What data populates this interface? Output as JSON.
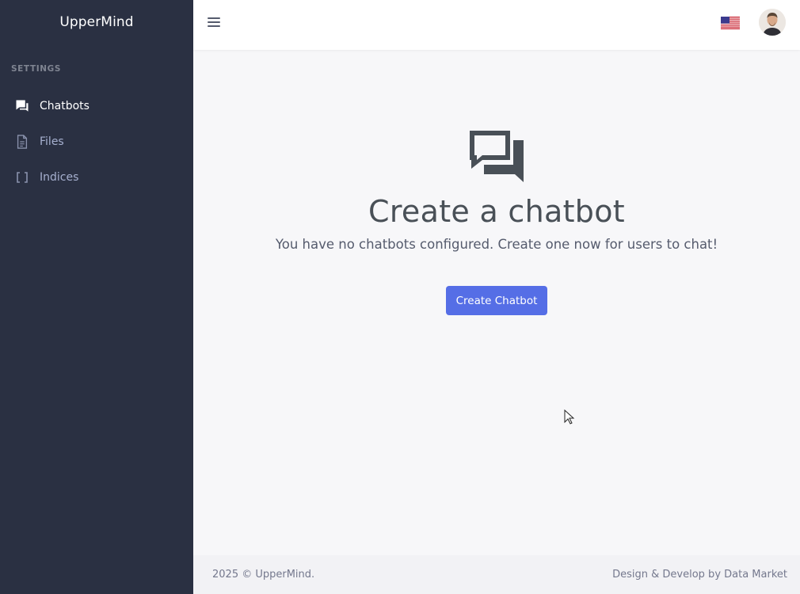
{
  "app": {
    "brand": "UpperMind"
  },
  "sidebar": {
    "section_title": "SETTINGS",
    "items": [
      {
        "label": "Chatbots",
        "icon": "chat-bubbles-icon",
        "active": true
      },
      {
        "label": "Files",
        "icon": "file-icon",
        "active": false
      },
      {
        "label": "Indices",
        "icon": "brackets-icon",
        "active": false
      }
    ]
  },
  "topbar": {
    "menu_icon": "hamburger-icon",
    "language_icon": "us-flag-icon",
    "avatar_icon": "user-avatar"
  },
  "empty_state": {
    "icon": "chat-bubbles-icon",
    "title": "Create a chatbot",
    "description": "You have no chatbots configured. Create one now for users to chat!",
    "button_label": "Create Chatbot"
  },
  "footer": {
    "copyright": "2025 © UpperMind.",
    "credit": "Design & Develop by Data Market"
  },
  "colors": {
    "sidebar_bg": "#2a3042",
    "accent": "#556ee6",
    "page_bg": "#f7f7f9"
  }
}
